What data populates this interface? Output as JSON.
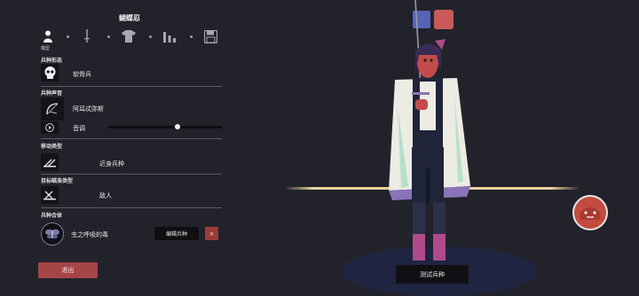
{
  "editor": {
    "title": "蝴蝶忍",
    "steps": [
      {
        "icon": "person-icon",
        "label": "模型"
      },
      {
        "icon": "sword-icon",
        "label": ""
      },
      {
        "icon": "armor-icon",
        "label": ""
      },
      {
        "icon": "stats-icon",
        "label": ""
      },
      {
        "icon": "save-icon",
        "label": ""
      }
    ],
    "sections": {
      "form": {
        "label": "兵种形态",
        "value": "软骨兵"
      },
      "voice": {
        "label": "兵种声音",
        "value": "阿耳忒弥斯",
        "pitch_label": "音调",
        "pitch_level": 0.61
      },
      "movement": {
        "label": "移动类型",
        "value": "近身兵种"
      },
      "targeting": {
        "label": "目标瞄准类型",
        "value": "敌人"
      },
      "fusion": {
        "label": "兵种合体",
        "value": "虫之呼吸的毒",
        "edit_label": "编辑兵种",
        "delete_label": "×"
      }
    },
    "exit_label": "退出"
  },
  "scene": {
    "test_label": "测试兵种",
    "colors": {
      "team_blue": "#5664b6",
      "team_red": "#c85a5a",
      "accent_exit": "#a54548",
      "ground_line": "#e7d19c"
    }
  }
}
